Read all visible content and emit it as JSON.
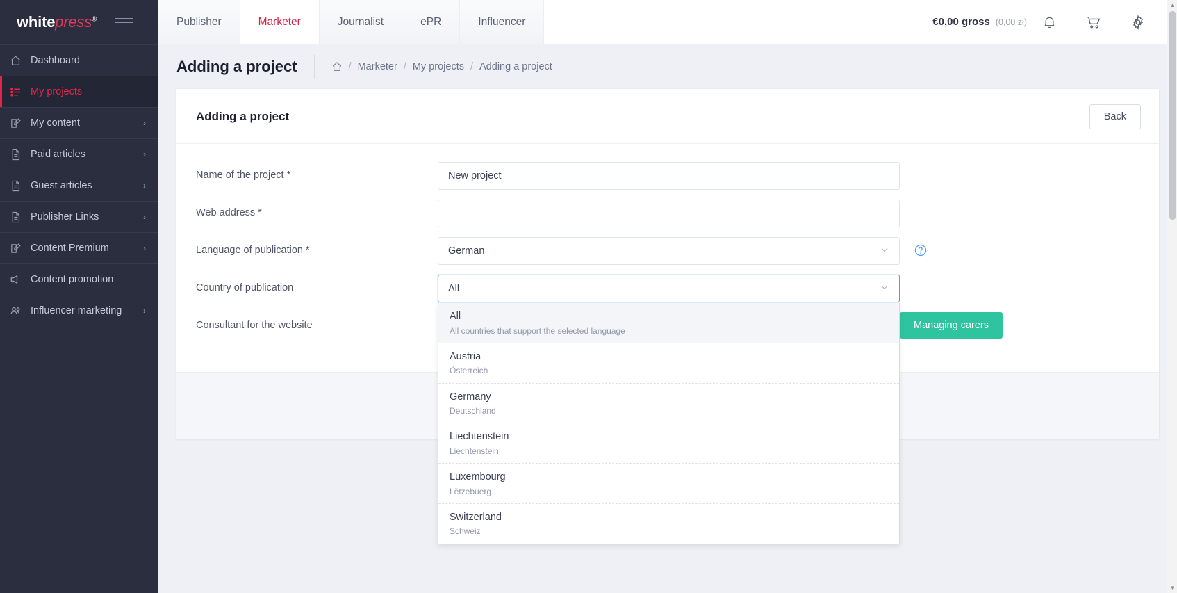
{
  "brand": {
    "logo_part1": "white",
    "logo_part2": "press",
    "logo_reg": "®",
    "accent_red": "#e0274b",
    "sidebar_bg": "#2b2e3f",
    "page_bg": "#eef0f5",
    "green": "#2ec4a0",
    "focus_blue": "#3da5f4"
  },
  "sidebar": {
    "items": [
      {
        "label": "Dashboard",
        "icon": "home-icon",
        "has_chevron": false,
        "active": false
      },
      {
        "label": "My projects",
        "icon": "list-icon",
        "has_chevron": false,
        "active": true
      },
      {
        "label": "My content",
        "icon": "edit-icon",
        "has_chevron": true,
        "active": false
      },
      {
        "label": "Paid articles",
        "icon": "document-icon",
        "has_chevron": true,
        "active": false
      },
      {
        "label": "Guest articles",
        "icon": "document-icon",
        "has_chevron": true,
        "active": false
      },
      {
        "label": "Publisher Links",
        "icon": "document-icon",
        "has_chevron": true,
        "active": false
      },
      {
        "label": "Content Premium",
        "icon": "edit-icon",
        "has_chevron": true,
        "active": false
      },
      {
        "label": "Content promotion",
        "icon": "megaphone-icon",
        "has_chevron": false,
        "active": false
      },
      {
        "label": "Influencer marketing",
        "icon": "users-icon",
        "has_chevron": true,
        "active": false
      }
    ],
    "chevron_glyph": "›"
  },
  "topbar": {
    "tabs": [
      {
        "label": "Publisher",
        "active": false
      },
      {
        "label": "Marketer",
        "active": true
      },
      {
        "label": "Journalist",
        "active": false
      },
      {
        "label": "ePR",
        "active": false
      },
      {
        "label": "Influencer",
        "active": false
      }
    ],
    "balance": "€0,00 gross",
    "balance_secondary": "(0,00 zł)",
    "icons": [
      "bell-icon",
      "cart-icon",
      "gear-icon"
    ]
  },
  "page": {
    "title": "Adding a project",
    "breadcrumb": {
      "home_icon": "home-icon",
      "separator": "/",
      "items": [
        "Marketer",
        "My projects",
        "Adding a project"
      ]
    }
  },
  "card": {
    "title": "Adding a project",
    "back_label": "Back"
  },
  "form": {
    "fields": [
      {
        "label": "Name of the project *",
        "value": "New project",
        "placeholder": ""
      },
      {
        "label": "Web address *",
        "value": "",
        "placeholder": ""
      }
    ],
    "language": {
      "label": "Language of publication *",
      "value": "German",
      "chevron": "chevron-down-icon",
      "help_icon": "help-circle-icon"
    },
    "country": {
      "label": "Country of publication",
      "value": "All",
      "chevron": "chevron-down-icon",
      "focused": true,
      "options": [
        {
          "title": "All",
          "sub": "All countries that support the selected language",
          "selected": true
        },
        {
          "title": "Austria",
          "sub": "Österreich",
          "selected": false
        },
        {
          "title": "Germany",
          "sub": "Deutschland",
          "selected": false
        },
        {
          "title": "Liechtenstein",
          "sub": "Liechtenstein",
          "selected": false
        },
        {
          "title": "Luxembourg",
          "sub": "Lëtzebuerg",
          "selected": false
        },
        {
          "title": "Switzerland",
          "sub": "Schweiz",
          "selected": false
        }
      ]
    },
    "consultant": {
      "label": "Consultant for the website",
      "button_label": "Managing carers"
    }
  },
  "scrollbar": {
    "up_glyph": "▲",
    "down_glyph": "▼"
  }
}
